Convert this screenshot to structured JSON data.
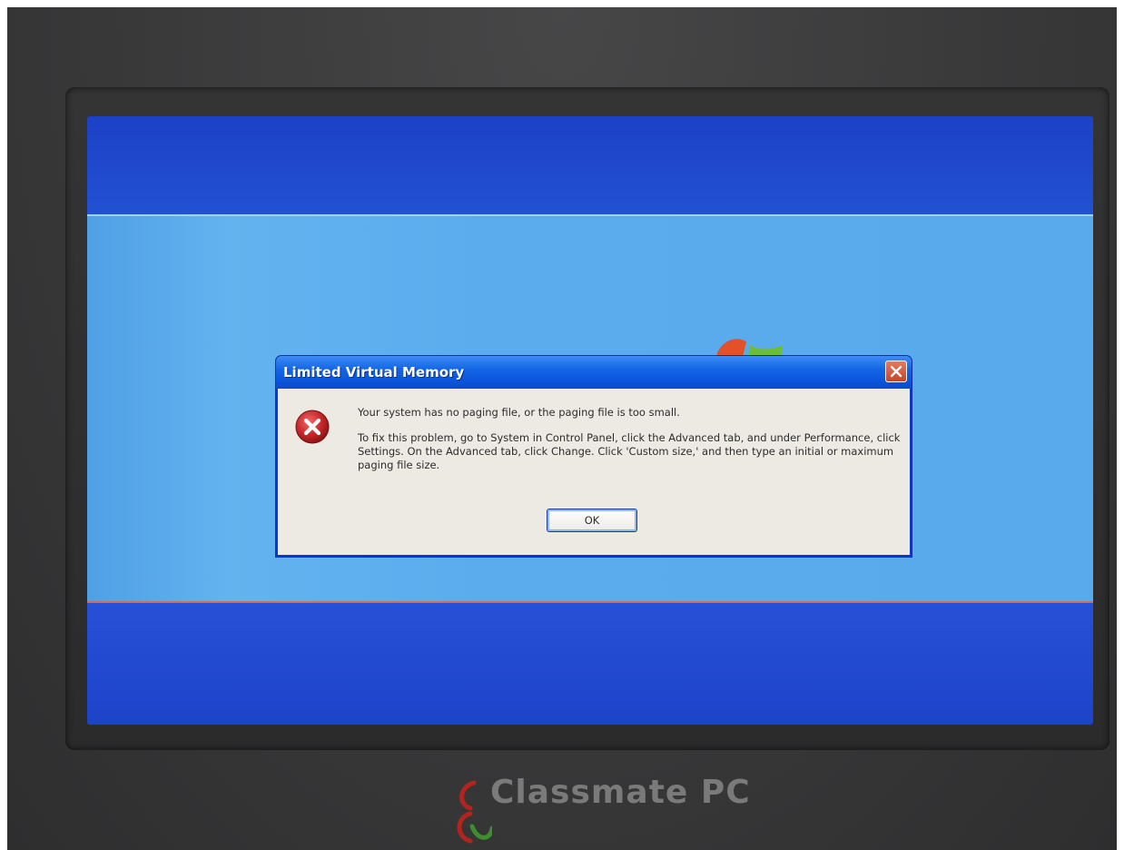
{
  "dialog": {
    "title": "Limited Virtual Memory",
    "message_line1": "Your system has no paging file, or the paging file is too small.",
    "message_line2": "To fix this problem, go to System in Control Panel, click the Advanced tab, and under Performance, click Settings. On the Advanced tab, click Change. Click 'Custom size,' and then type an initial or maximum paging file size.",
    "ok_label": "OK",
    "icon": "error-icon",
    "close_icon": "close-icon"
  },
  "device": {
    "brand_name": "Classmate PC",
    "logo_icon": "classmate-logo-icon"
  },
  "colors": {
    "title_bar": "#0b55dc",
    "desktop_band": "#58aaec",
    "dialog_body": "#eceae2",
    "close_button": "#c6442a",
    "error_red": "#c8282a"
  }
}
